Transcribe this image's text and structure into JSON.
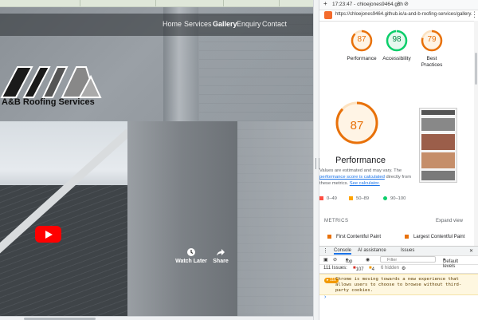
{
  "site": {
    "nav": [
      "Home",
      "Services",
      "Gallery",
      "Enquiry",
      "Contact"
    ],
    "active_nav": "Gallery",
    "brand": "A&B Roofing Services",
    "video": {
      "watch_later": "Watch Later",
      "share": "Share"
    }
  },
  "devtools": {
    "toolbar": {
      "time": "17:23:47 - chloejones9464.gith"
    },
    "url": "https://chloejones9464.github.io/a-and-b-roofing-services/gallery.",
    "scores": [
      {
        "label": "Performance",
        "value": 87,
        "color": "#e8710a"
      },
      {
        "label": "Accessibility",
        "value": 98,
        "color": "#0cce6b"
      },
      {
        "label": "Best Practices",
        "value": 79,
        "color": "#e8710a"
      }
    ],
    "perf": {
      "value": 87,
      "title": "Performance",
      "desc_1": "Values are estimated and may vary. The",
      "desc_link_1": "performance score is calculated",
      "desc_2": " directly from these",
      "desc_3": "metrics.",
      "desc_link_2": "See calculator."
    },
    "legend": {
      "low": "0–49",
      "mid": "50–89",
      "high": "90–100"
    },
    "metrics_heading": "METRICS",
    "expand_view": "Expand view",
    "metric_fcp": "First Contentful Paint",
    "metric_lcp": "Largest Contentful Paint",
    "drawer": {
      "console": "Console",
      "ai": "AI assistance",
      "issues": "Issues",
      "close": "✕"
    },
    "console": {
      "context": "top",
      "filter_placeholder": "Filter",
      "levels": "Default levels",
      "issues_summary": "111 Issues:",
      "issues_red": "107",
      "issues_yellow": "4",
      "hidden": "6 hidden",
      "warn_count": "118",
      "warning": "Chrome is moving towards a new experience that allows users to choose to browse without third-party cookies.",
      "prompt": "›"
    }
  }
}
